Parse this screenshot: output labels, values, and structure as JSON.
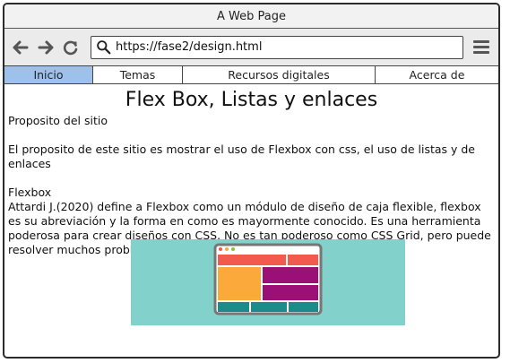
{
  "window": {
    "title": "A Web Page"
  },
  "toolbar": {
    "back_icon": "back-arrow-icon",
    "forward_icon": "forward-arrow-icon",
    "reload_icon": "reload-icon",
    "search_icon": "search-icon",
    "url": "https://fase2/design.html",
    "menu_icon": "hamburger-menu-icon"
  },
  "nav": {
    "tabs": [
      {
        "label": "Inicio",
        "active": true
      },
      {
        "label": "Temas",
        "active": false
      },
      {
        "label": "Recursos digitales",
        "active": false
      },
      {
        "label": "Acerca de",
        "active": false
      }
    ]
  },
  "page": {
    "heading": "Flex Box, Listas y enlaces",
    "section1_title": "Proposito del sitio",
    "section1_text": "El proposito de este sitio es mostrar el uso de Flexbox con css, el uso de listas y de enlaces",
    "section2_title": "Flexbox",
    "section2_text": "Attardi J.(2020) define a Flexbox como un módulo de diseño de caja flexible, flexbox es su abreviación y la forma en como es mayormente conocido. Es una herramienta poderosa para crear diseños con CSS. No es tan poderoso como CSS Grid, pero puede resolver muchos problemas de diseño."
  },
  "colors": {
    "active_tab": "#9ec1ec",
    "image_bg": "#82d2cb",
    "layout_red": "#f25a4e",
    "layout_orange": "#fba93a",
    "layout_purple": "#9a1077",
    "layout_teal": "#1e8a8a"
  }
}
